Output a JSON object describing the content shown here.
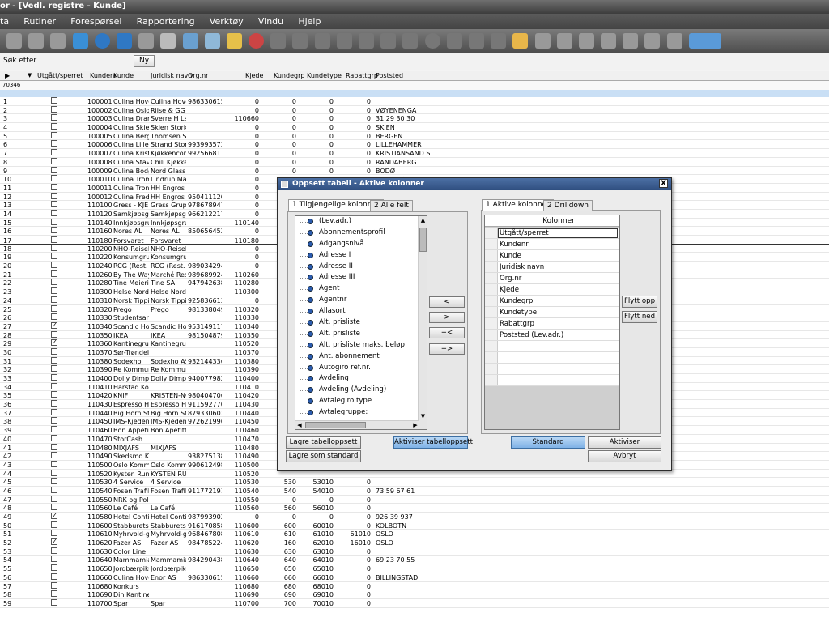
{
  "title": "or - [Vedl. registre - Kunde]",
  "menu": [
    "ta",
    "Rutiner",
    "Forespørsel",
    "Rapportering",
    "Verktøy",
    "Vindu",
    "Hjelp"
  ],
  "search": {
    "label": "Søk etter",
    "button": "Ny"
  },
  "grid": {
    "headers": {
      "utgatt": "Utgått/sperret",
      "kundenr": "Kundenr",
      "kunde": "Kunde",
      "juridisk": "Juridisk navn",
      "orgnr": "Org.nr",
      "kjede": "Kjede",
      "kundegrp": "Kundegrp",
      "kundetype": "Kundetype",
      "rabattgrp": "Rabattgrp",
      "poststed": "Poststed"
    },
    "row_count_label": "70346",
    "rows": [
      [
        "1",
        "",
        "100001",
        "Culina Hoved",
        "Culina Hoved",
        "986330615",
        "0",
        "0",
        "0",
        "0",
        ""
      ],
      [
        "2",
        "",
        "100002",
        "Culina Oslo",
        "Riise & GG S",
        "",
        "0",
        "0",
        "0",
        "0",
        "VØYENENGA"
      ],
      [
        "3",
        "",
        "100003",
        "Culina Dram",
        "Sverre H Lag",
        "",
        "110660",
        "0",
        "0",
        "0",
        "31 29 30 30"
      ],
      [
        "4",
        "",
        "100004",
        "Culina Skien",
        "Skien Storkjø",
        "",
        "0",
        "0",
        "0",
        "0",
        "SKIEN"
      ],
      [
        "5",
        "",
        "100005",
        "Culina Berge",
        "Thomsen Sto",
        "",
        "0",
        "0",
        "0",
        "0",
        "BERGEN"
      ],
      [
        "6",
        "",
        "100006",
        "Culina Lilleha",
        "Strand Storkj",
        "993993573",
        "0",
        "0",
        "0",
        "0",
        "LILLEHAMMER"
      ],
      [
        "7",
        "",
        "100007",
        "Culina Kristia",
        "Kjøkkencomp",
        "992566817",
        "0",
        "0",
        "0",
        "0",
        "KRISTIANSAND S"
      ],
      [
        "8",
        "",
        "100008",
        "Culina Stava",
        "Chili Kjøkken",
        "",
        "0",
        "0",
        "0",
        "0",
        "RANDABERG"
      ],
      [
        "9",
        "",
        "100009",
        "Culina Bodø",
        "Nord Glass A",
        "",
        "0",
        "0",
        "0",
        "0",
        "BODØ"
      ],
      [
        "10",
        "",
        "100010",
        "Culina Troms",
        "Lindrup Marti",
        "",
        "0",
        "0",
        "0",
        "0",
        "TROMSØ"
      ],
      [
        "11",
        "",
        "100011",
        "Culina Trondh",
        "HH Engros A",
        "",
        "0",
        "",
        "",
        "",
        ""
      ],
      [
        "12",
        "",
        "100012",
        "Culina Fredri",
        "HH Engros A",
        "950411120",
        "0",
        "",
        "",
        "",
        ""
      ],
      [
        "13",
        "",
        "110100",
        "Gress - KJE",
        "Gress Grupp",
        "978678947",
        "0",
        "",
        "",
        "",
        ""
      ],
      [
        "14",
        "",
        "110120",
        "Samkjøpsgru",
        "Samkjøpsgru",
        "966212217",
        "0",
        "",
        "",
        "",
        ""
      ],
      [
        "15",
        "",
        "110140",
        "Innkjøpsgrup",
        "Innkjøpsgrup",
        "",
        "110140",
        "",
        "",
        "",
        ""
      ],
      [
        "16",
        "",
        "110160",
        "Nores AL",
        "Nores AL",
        "850656452",
        "0",
        "",
        "",
        "",
        ""
      ],
      [
        "17",
        "",
        "110180",
        "Forsvaret",
        "Forsvaret",
        "",
        "110180",
        "",
        "",
        "",
        ""
      ],
      [
        "18",
        "",
        "110200",
        "NHO-Reiseli",
        "NHO-Reiseli",
        "",
        "0",
        "",
        "",
        "",
        ""
      ],
      [
        "19",
        "",
        "110220",
        "Konsumgrupp",
        "Konsumgrupp",
        "",
        "0",
        "",
        "",
        "",
        ""
      ],
      [
        "20",
        "",
        "110240",
        "RCG (Rest.",
        "RCG (Rest.",
        "989034294",
        "0",
        "",
        "",
        "",
        ""
      ],
      [
        "21",
        "",
        "110260",
        "By The Way",
        "Marché Rest",
        "989689924",
        "110260",
        "",
        "",
        "",
        ""
      ],
      [
        "22",
        "",
        "110280",
        "Tine Meierier",
        "Tine SA",
        "947942638",
        "110280",
        "",
        "",
        "",
        ""
      ],
      [
        "23",
        "",
        "110300",
        "Helse Nord",
        "Helse Nord",
        "",
        "110300",
        "",
        "",
        "",
        ""
      ],
      [
        "24",
        "",
        "110310",
        "Norsk Tipping",
        "Norsk Tipping",
        "925836613",
        "0",
        "",
        "",
        "",
        ""
      ],
      [
        "25",
        "",
        "110320",
        "Prego",
        "Prego",
        "981338049",
        "110320",
        "",
        "",
        "",
        ""
      ],
      [
        "26",
        "",
        "110330",
        "Studentsams",
        "",
        "",
        "110330",
        "",
        "",
        "",
        ""
      ],
      [
        "27",
        "1",
        "110340",
        "Scandic Hote",
        "Scandic Hote",
        "953149117",
        "110340",
        "",
        "",
        "",
        ""
      ],
      [
        "28",
        "",
        "110350",
        "IKEA",
        "IKEA",
        "981504879",
        "110350",
        "",
        "",
        "",
        ""
      ],
      [
        "29",
        "1",
        "110360",
        "Kantinegrupp",
        "Kantinegrupp",
        "",
        "110520",
        "",
        "",
        "",
        ""
      ],
      [
        "30",
        "",
        "110370",
        "Sør-Trøndelag",
        "",
        "",
        "110370",
        "",
        "",
        "",
        ""
      ],
      [
        "31",
        "",
        "110380",
        "Sodexho",
        "Sodexho AS",
        "932144336",
        "110380",
        "",
        "",
        "",
        ""
      ],
      [
        "32",
        "",
        "110390",
        "Re Kommune",
        "Re Kommune",
        "",
        "110390",
        "",
        "",
        "",
        ""
      ],
      [
        "33",
        "",
        "110400",
        "Dolly Dimple'",
        "Dolly Dimple",
        "940077982",
        "110400",
        "",
        "",
        "",
        ""
      ],
      [
        "34",
        "",
        "110410",
        "Harstad Kom",
        "",
        "",
        "110410",
        "",
        "",
        "",
        ""
      ],
      [
        "35",
        "",
        "110420",
        "KNIF",
        "KRISTEN-NO",
        "980404706",
        "110420",
        "",
        "",
        "",
        ""
      ],
      [
        "36",
        "",
        "110430",
        "Espresso Ho",
        "Espresso Ho",
        "911592770",
        "110430",
        "",
        "",
        "",
        ""
      ],
      [
        "37",
        "",
        "110440",
        "Big Horn Ste",
        "Big Horn Ste",
        "879330602",
        "110440",
        "",
        "",
        "",
        ""
      ],
      [
        "38",
        "",
        "110450",
        "IMS-Kjeden A",
        "IMS-Kjeden A",
        "972621996",
        "110450",
        "",
        "",
        "",
        ""
      ],
      [
        "39",
        "",
        "110460",
        "Bon Appetit",
        "Bon Apetitt D",
        "",
        "110460",
        "",
        "",
        "",
        ""
      ],
      [
        "40",
        "",
        "110470",
        "StorCash",
        "",
        "",
        "110470",
        "",
        "",
        "",
        ""
      ],
      [
        "41",
        "",
        "110480",
        "MIXJAFS",
        "MIXJAFS",
        "",
        "110480",
        "",
        "",
        "",
        ""
      ],
      [
        "42",
        "",
        "110490",
        "Skedsmo Ko",
        "",
        "938275138",
        "110490",
        "",
        "",
        "",
        ""
      ],
      [
        "43",
        "",
        "110500",
        "Oslo Kommu",
        "Oslo Kommu",
        "990612498",
        "110500",
        "",
        "",
        "",
        ""
      ],
      [
        "44",
        "",
        "110520",
        "Kysten Rund",
        "KYSTEN RU",
        "",
        "110520",
        "",
        "",
        "",
        ""
      ],
      [
        "45",
        "",
        "110530",
        "4 Service",
        "4 Service",
        "",
        "110530",
        "530",
        "53010",
        "0",
        ""
      ],
      [
        "46",
        "",
        "110540",
        "Fosen Trafik",
        "Fosen Trafik",
        "911772191",
        "110540",
        "540",
        "54010",
        "0",
        "73 59 67 61"
      ],
      [
        "47",
        "",
        "110550",
        "NRK og Politi",
        "",
        "",
        "110550",
        "0",
        "0",
        "0",
        ""
      ],
      [
        "48",
        "",
        "110560",
        "Le Café",
        "Le Café",
        "",
        "110560",
        "560",
        "56010",
        "0",
        ""
      ],
      [
        "49",
        "1",
        "110580",
        "Hotel Contine",
        "Hotel Contine",
        "987993902",
        "0",
        "0",
        "0",
        "0",
        "926 39 937"
      ],
      [
        "50",
        "",
        "110600",
        "Stabburets K",
        "Stabburets K",
        "916170858",
        "110600",
        "600",
        "60010",
        "0",
        "KOLBOTN"
      ],
      [
        "51",
        "",
        "110610",
        "Myhrvold-gru",
        "Myhrvold-gru",
        "968467808",
        "110610",
        "610",
        "61010",
        "61010",
        "OSLO"
      ],
      [
        "52",
        "1",
        "110620",
        "Fazer AS",
        "Fazer AS",
        "984785224",
        "110620",
        "160",
        "62010",
        "16010",
        "OSLO"
      ],
      [
        "53",
        "",
        "110630",
        "Color Line",
        "",
        "",
        "110630",
        "630",
        "63010",
        "0",
        ""
      ],
      [
        "54",
        "",
        "110640",
        "Mammamia",
        "Mammamia",
        "984290438",
        "110640",
        "640",
        "64010",
        "0",
        "69 23 70 55"
      ],
      [
        "55",
        "",
        "110650",
        "Jordbærpiken",
        "Jordbærpiken",
        "",
        "110650",
        "650",
        "65010",
        "0",
        ""
      ],
      [
        "56",
        "",
        "110660",
        "Culina Hoved",
        "Enor AS",
        "986330615",
        "110660",
        "660",
        "66010",
        "0",
        "BILLINGSTAD"
      ],
      [
        "57",
        "",
        "110680",
        "Konkurs",
        "",
        "",
        "110680",
        "680",
        "68010",
        "0",
        ""
      ],
      [
        "58",
        "",
        "110690",
        "Din Kantinep",
        "",
        "",
        "110690",
        "690",
        "69010",
        "0",
        ""
      ],
      [
        "59",
        "",
        "110700",
        "Spar",
        "Spar",
        "",
        "110700",
        "700",
        "70010",
        "0",
        ""
      ]
    ]
  },
  "dialog": {
    "title": "Oppsett tabell - Aktive kolonner",
    "close": "X",
    "left_tabs": [
      "1 Tilgjengelige kolonner",
      "2 Alle felt"
    ],
    "right_tabs": [
      "1 Aktive kolonner",
      "2 Drilldown"
    ],
    "available": [
      "(Lev.adr.)",
      "Abonnementsprofil",
      "Adgangsnivå",
      "Adresse I",
      "Adresse II",
      "Adresse III",
      "Agent",
      "Agentnr",
      "Allasort",
      "Alt. prisliste",
      "Alt. prisliste",
      "Alt. prisliste maks. beløp",
      "Ant. abonnement",
      "Autogiro ref.nr.",
      "Avdeling",
      "Avdeling (Avdeling)",
      "Avtalegiro type",
      "Avtalegruppe:"
    ],
    "move_buttons": [
      "<",
      ">",
      "+<",
      "+>"
    ],
    "columns_header": "Kolonner",
    "active": [
      "Utgått/sperret",
      "Kundenr",
      "Kunde",
      "Juridisk navn",
      "Org.nr",
      "Kjede",
      "Kundegrp",
      "Kundetype",
      "Rabattgrp",
      "Poststed (Lev.adr.)"
    ],
    "btn_move_up": "Flytt opp",
    "btn_move_down": "Flytt ned",
    "btn_save_layout": "Lagre tabelloppsett",
    "btn_save_default": "Lagre som standard",
    "btn_activate_layout": "Aktiviser tabelloppsett",
    "btn_standard": "Standard",
    "btn_activate": "Aktiviser",
    "btn_cancel": "Avbryt"
  }
}
